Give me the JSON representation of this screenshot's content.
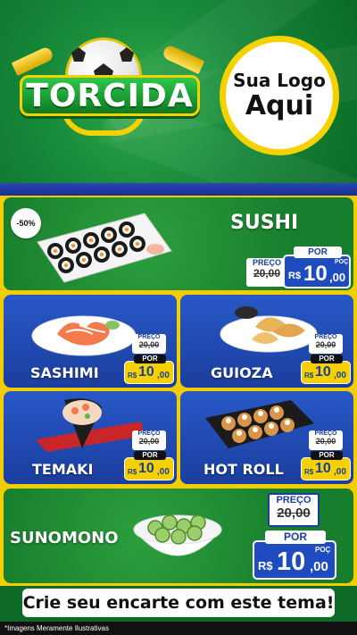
{
  "hero": {
    "brand": "TORCIDA",
    "logo_line1": "Sua Logo",
    "logo_line2": "Aqui"
  },
  "products": [
    {
      "name": "SUSHI",
      "badge": "-50%",
      "price_label": "PREÇO",
      "old_price": "20,00",
      "por_label": "POR",
      "currency": "R$",
      "price_int": "10",
      "price_dec": ",00",
      "unit": "POÇ"
    },
    {
      "name": "SASHIMI",
      "price_label": "PREÇO",
      "old_price": "20,00",
      "por_label": "POR",
      "currency": "R$",
      "price_int": "10",
      "price_dec": ",00"
    },
    {
      "name": "GUIOZA",
      "price_label": "PREÇO",
      "old_price": "20,00",
      "por_label": "POR",
      "currency": "R$",
      "price_int": "10",
      "price_dec": ",00"
    },
    {
      "name": "TEMAKI",
      "price_label": "PREÇO",
      "old_price": "20,00",
      "por_label": "POR",
      "currency": "R$",
      "price_int": "10",
      "price_dec": ",00"
    },
    {
      "name": "HOT ROLL",
      "price_label": "PREÇO",
      "old_price": "20,00",
      "por_label": "POR",
      "currency": "R$",
      "price_int": "10",
      "price_dec": ",00"
    },
    {
      "name": "SUNOMONO",
      "price_label": "PREÇO",
      "old_price": "20,00",
      "por_label": "POR",
      "currency": "R$",
      "price_int": "10",
      "price_dec": ",00",
      "unit": "POÇ"
    }
  ],
  "cta": "Crie seu encarte com este tema!",
  "disclaimer": "*Imagens Meramente Ilustrativas",
  "colors": {
    "green": "#177e2d",
    "blue": "#1b3e9e",
    "yellow": "#f2cd00"
  }
}
